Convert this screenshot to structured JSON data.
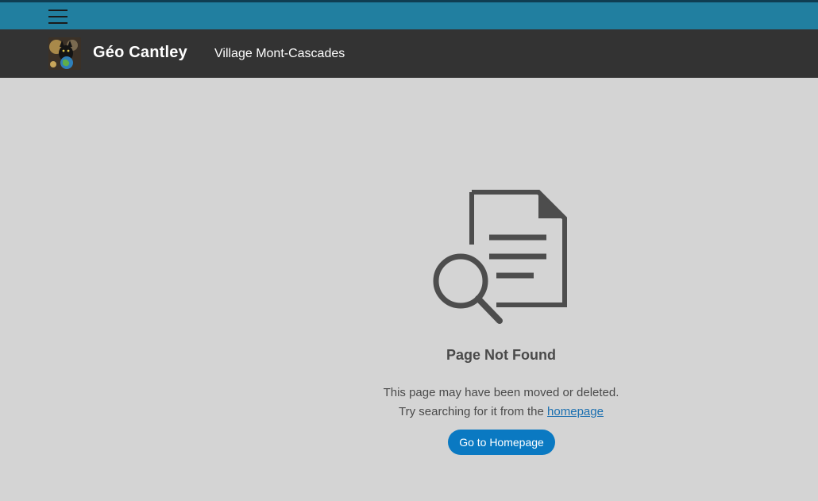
{
  "topbar": {
    "menu_icon": "hamburger-menu-icon"
  },
  "header": {
    "site_title": "Géo Cantley",
    "nav_link": "Village Mont-Cascades",
    "logo_icon": "site-logo"
  },
  "not_found": {
    "icon": "document-search-icon",
    "title": "Page Not Found",
    "line1": "This page may have been moved or deleted.",
    "line2_prefix": "Try searching for it from the ",
    "line2_link": "homepage",
    "button_label": "Go to Homepage"
  },
  "colors": {
    "topbar": "#217fa0",
    "header": "#333333",
    "background": "#d4d4d4",
    "button": "#0a79c2",
    "link": "#1a6fb0"
  }
}
